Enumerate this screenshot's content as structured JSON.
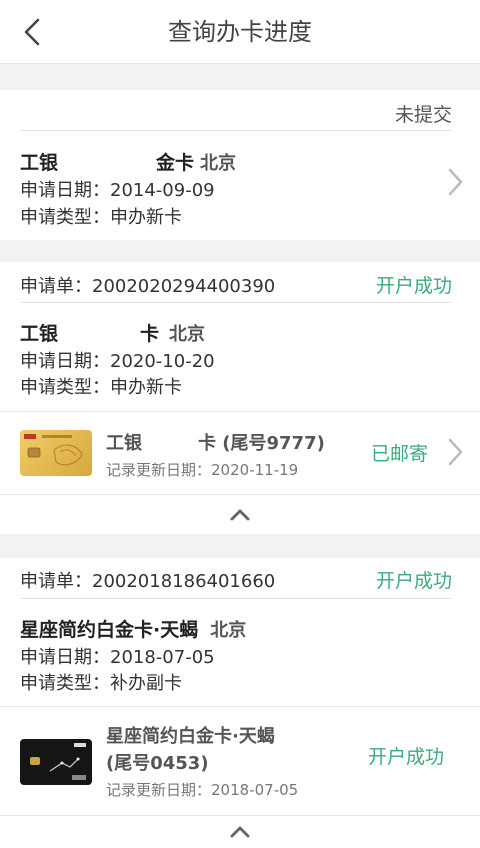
{
  "header": {
    "title": "查询办卡进度"
  },
  "applications": [
    {
      "status": "未提交",
      "card_name_left": "工银",
      "card_name_right": "金卡",
      "city": "北京",
      "date_label": "申请日期：",
      "date": "2014-09-09",
      "type_label": "申请类型：",
      "type": "申办新卡"
    },
    {
      "order_label": "申请单：",
      "order_no": "2002020294400390",
      "status": "开户成功",
      "card_name_left": "工银",
      "card_name_right": "卡",
      "city": "北京",
      "date_label": "申请日期：",
      "date": "2020-10-20",
      "type_label": "申请类型：",
      "type": "申办新卡",
      "card": {
        "name_left": "工银",
        "name_right": "卡 (尾号9777)",
        "update_label": "记录更新日期：",
        "update_date": "2020-11-19",
        "status": "已邮寄"
      }
    },
    {
      "order_label": "申请单：",
      "order_no": "2002018186401660",
      "status": "开户成功",
      "card_name": "星座简约白金卡·天蝎",
      "city": "北京",
      "date_label": "申请日期：",
      "date": "2018-07-05",
      "type_label": "申请类型：",
      "type": "补办副卡",
      "card": {
        "name": "星座简约白金卡·天蝎",
        "tail": "(尾号0453)",
        "update_label": "记录更新日期：",
        "update_date": "2018-07-05",
        "status": "开户成功"
      }
    }
  ],
  "colors": {
    "success": "#3cab7a",
    "gold_card": "#e2b64a",
    "black_card": "#1a1a1a"
  },
  "icons": {
    "back": "chevron-left-icon",
    "row_arrow": "chevron-right-icon",
    "collapse": "chevron-up-icon"
  }
}
